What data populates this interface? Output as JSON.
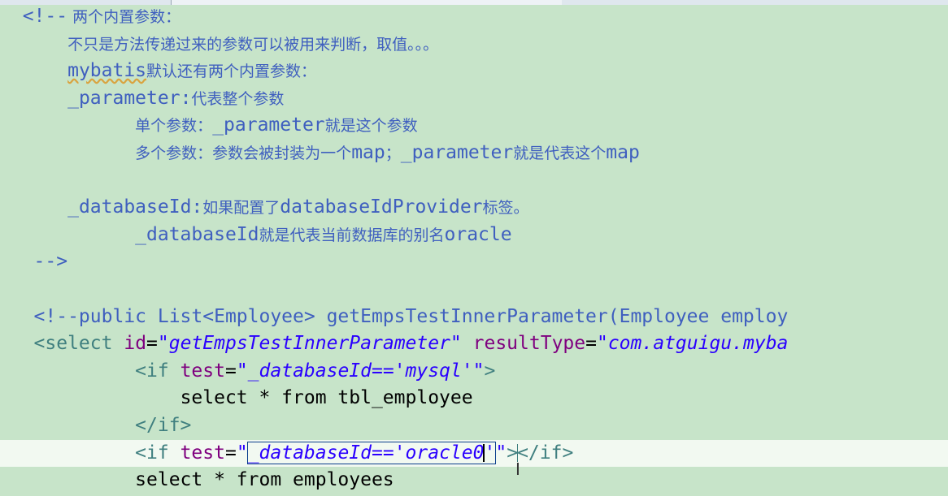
{
  "editor": {
    "language": "xml",
    "lines": [
      {
        "open": "<!--",
        "comment": " 两个内置参数："
      },
      {
        "comment": "不只是方法传递过来的参数可以被用来判断，取值。。。"
      },
      {
        "mono": "mybatis",
        "comment": "默认还有两个内置参数："
      },
      {
        "mono": "_parameter:",
        "comment": "代表整个参数"
      },
      {
        "comment": "单个参数：",
        "mono": "_parameter",
        "comment2": "就是这个参数"
      },
      {
        "comment": "多个参数：参数会被封装为一个",
        "mono": "map",
        "comment2": "；",
        "mono2": "_parameter",
        "comment3": "就是代表这个",
        "mono3": "map"
      },
      {},
      {
        "mono": "_databaseId:",
        "comment": "如果配置了",
        "mono2": "databaseIdProvider",
        "comment2": "标签。"
      },
      {
        "mono": "_databaseId",
        "comment": "就是代表当前数据库的别名",
        "mono2": "oracle"
      },
      {
        "close": "-->"
      },
      {},
      {
        "text": "<!--public List<Employee> getEmpsTestInnerParameter(Employee employ"
      },
      {
        "tag_open": "<select",
        "attr1": "id",
        "val1": "\"getEmpsTestInnerParameter\"",
        "attr2": "resultType",
        "val2": "\"com.atguigu.myba"
      },
      {
        "tag_open": "<if",
        "attr1": "test",
        "val1": "\"_databaseId=='mysql'\"",
        "tag_close": ">"
      },
      {
        "text": "select * from tbl_employee"
      },
      {
        "tag": "</if>"
      },
      {
        "tag_open": "<if",
        "attr1": "test",
        "quote_open": "\"",
        "val_box": "_databaseId=='oracle0",
        "val_tail": "'",
        "quote_close": "\"",
        "tag_gt": ">",
        "tag_end": "</if>"
      },
      {
        "text": "select * from employees"
      }
    ]
  }
}
